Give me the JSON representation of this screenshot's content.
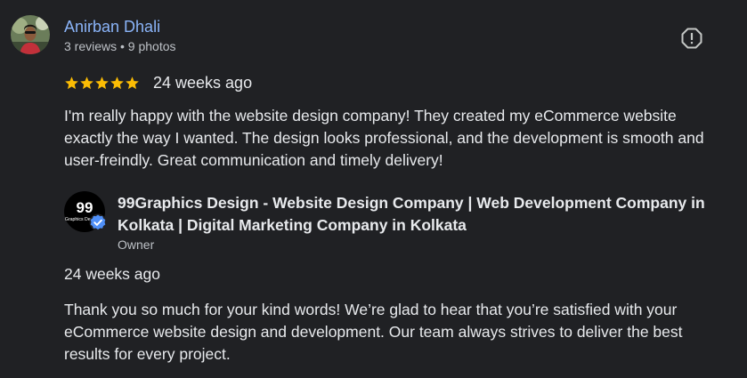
{
  "reviewer": {
    "name": "Anirban Dhali",
    "meta": "3 reviews • 9 photos",
    "avatar_icon": "person-photo"
  },
  "review": {
    "rating": 5,
    "rating_max": 5,
    "time": "24 weeks ago",
    "text": "I'm really happy with the website design company! They created my eCommerce website exactly the way I wanted. The design looks professional, and the development is smooth and user-freindly. Great communication and timely delivery!"
  },
  "report_icon": "report-flag-icon",
  "owner": {
    "logo_text": "99",
    "logo_subtext": "Graphics Design",
    "name": "99Graphics Design - Website Design Company | Web Development Company in Kolkata | Digital Marketing Company in Kolkata",
    "role": "Owner",
    "reply_time": "24 weeks ago",
    "reply_text": "Thank you so much for your kind words! We’re glad to hear that you’re satisfied with your eCommerce website design and development. Our team always strives to deliver the best results for every project."
  },
  "colors": {
    "background": "#202124",
    "link": "#8ab4f8",
    "star": "#fbbc04",
    "verified": "#1a73e8",
    "text": "#e8eaed",
    "muted": "#bdc1c6"
  }
}
